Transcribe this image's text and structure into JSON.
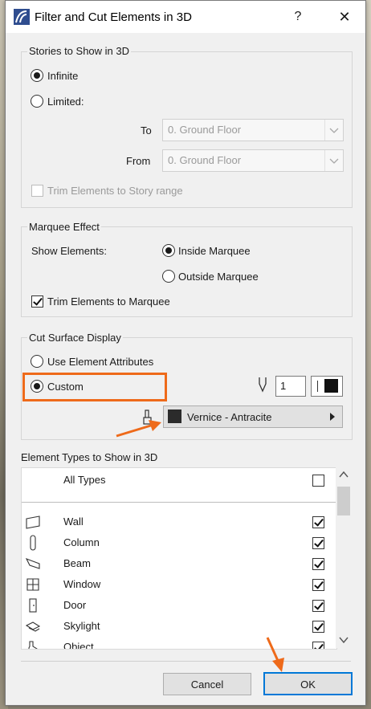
{
  "window": {
    "title": "Filter and Cut Elements in 3D",
    "help": "?",
    "close": "✕"
  },
  "stories": {
    "title": "Stories to Show in 3D",
    "infinite": "Infinite",
    "limited": "Limited:",
    "to_label": "To",
    "to_value": "0. Ground Floor",
    "from_label": "From",
    "from_value": "0. Ground Floor",
    "trim_label": "Trim Elements to Story range"
  },
  "marquee": {
    "title": "Marquee Effect",
    "show_label": "Show Elements:",
    "inside": "Inside Marquee",
    "outside": "Outside Marquee",
    "trim_label": "Trim Elements to Marquee"
  },
  "cut_surface": {
    "title": "Cut Surface Display",
    "use_attr": "Use Element Attributes",
    "custom": "Custom",
    "pen_value": "1",
    "material_value": "Vernice - Antracite"
  },
  "element_types": {
    "title": "Element Types to Show in 3D",
    "all_label": "All Types",
    "items": [
      {
        "label": "Wall",
        "icon": "wall-icon"
      },
      {
        "label": "Column",
        "icon": "column-icon"
      },
      {
        "label": "Beam",
        "icon": "beam-icon"
      },
      {
        "label": "Window",
        "icon": "window-icon"
      },
      {
        "label": "Door",
        "icon": "door-icon"
      },
      {
        "label": "Skylight",
        "icon": "skylight-icon"
      },
      {
        "label": "Object",
        "icon": "object-icon"
      }
    ]
  },
  "buttons": {
    "cancel": "Cancel",
    "ok": "OK"
  },
  "colors": {
    "highlight": "#ee6a1a",
    "accent": "#0078d7"
  }
}
